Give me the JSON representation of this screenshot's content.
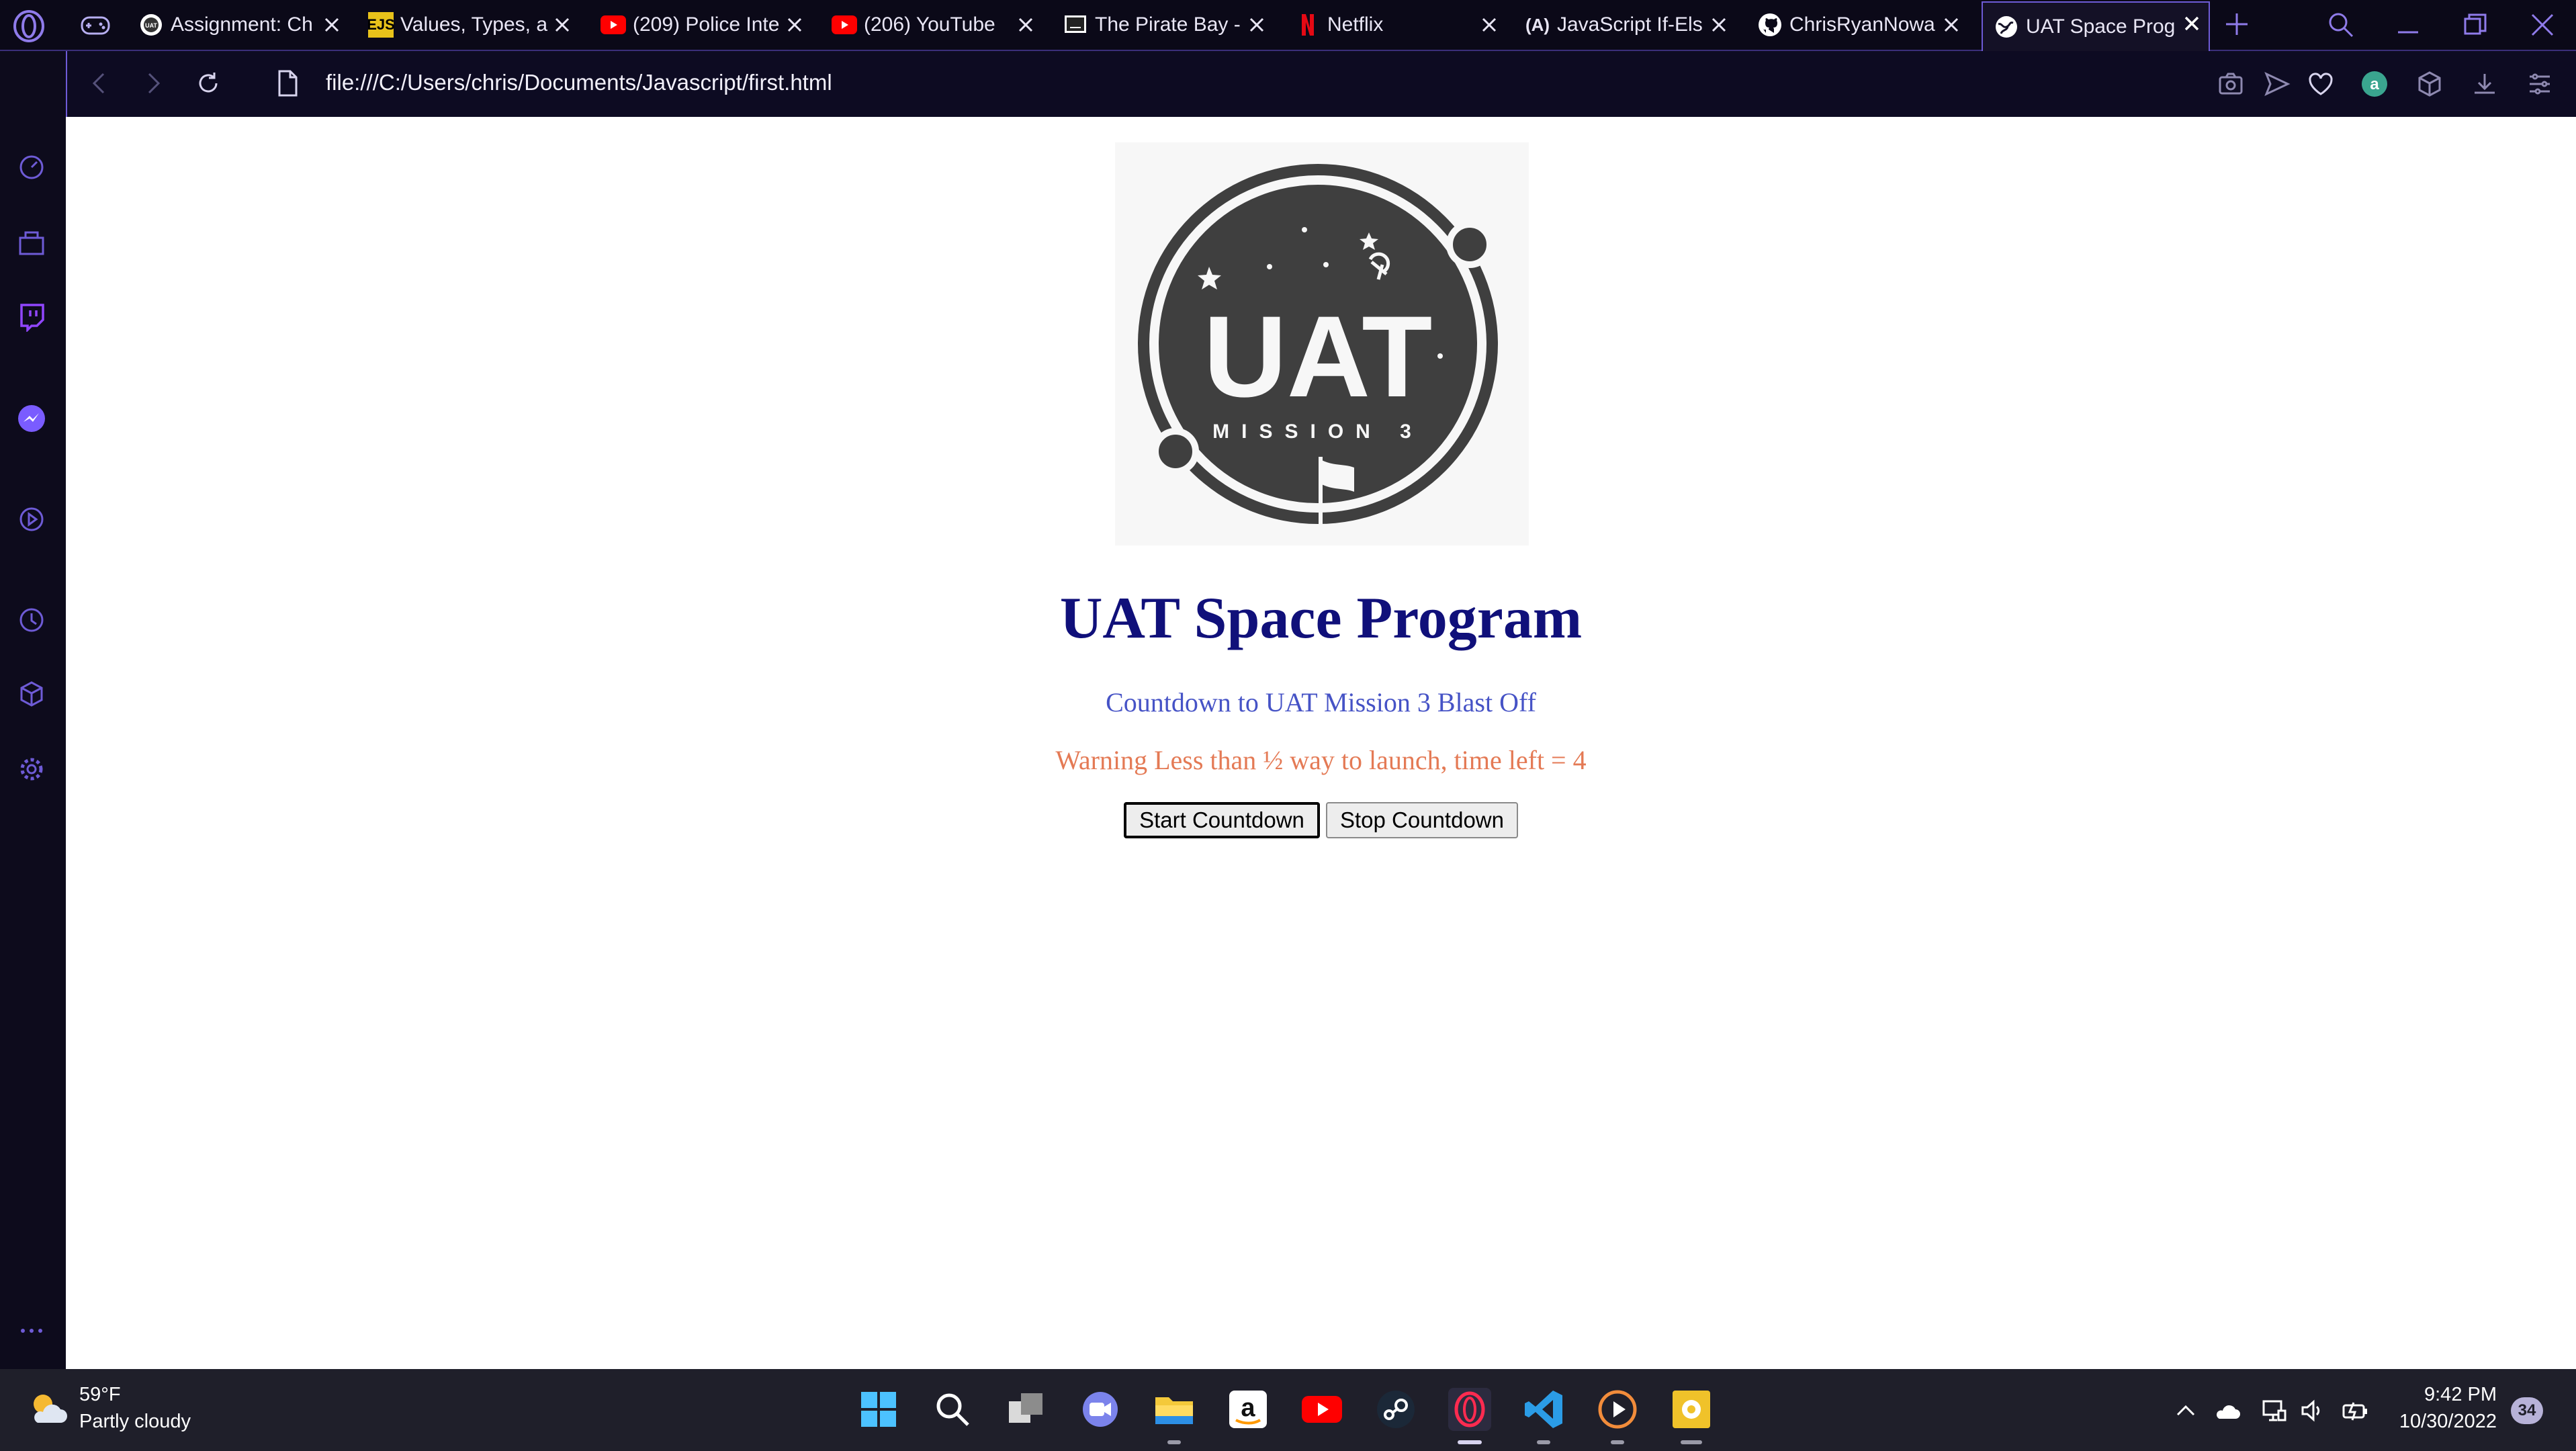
{
  "browser": {
    "tabs": [
      {
        "title": "Assignment: Ch",
        "favicon": "uat-favicon-icon"
      },
      {
        "title": "Values, Types, a",
        "favicon": "ejs-favicon-icon",
        "favicon_text": "EJS"
      },
      {
        "title": "(209) Police Inte",
        "favicon": "youtube-favicon-icon"
      },
      {
        "title": "(206) YouTube",
        "favicon": "youtube-favicon-icon"
      },
      {
        "title": "The Pirate Bay -",
        "favicon": "pirate-favicon-icon"
      },
      {
        "title": "Netflix",
        "favicon": "netflix-favicon-icon"
      },
      {
        "title": "JavaScript If-Els",
        "favicon": "a11y-favicon-icon",
        "favicon_text": "(A)"
      },
      {
        "title": "ChrisRyanNowa",
        "favicon": "github-favicon-icon"
      },
      {
        "title": "UAT Space Prog",
        "favicon": "globe-favicon-icon",
        "active": true
      }
    ],
    "url": "file:///C:/Users/chris/Documents/Javascript/first.html",
    "accent_color": "#6e5bd6"
  },
  "page": {
    "logo": {
      "main_text": "UAT",
      "sub_text": "MISSION 3"
    },
    "heading": "UAT Space Program",
    "subtitle": "Countdown to UAT Mission 3 Blast Off",
    "warning": "Warning Less than ½ way to launch, time left = 4",
    "buttons": {
      "start": "Start Countdown",
      "stop": "Stop Countdown"
    }
  },
  "taskbar": {
    "weather": {
      "temp": "59°F",
      "desc": "Partly cloudy"
    },
    "clock": {
      "time": "9:42 PM",
      "date": "10/30/2022"
    },
    "notifications": "34"
  }
}
